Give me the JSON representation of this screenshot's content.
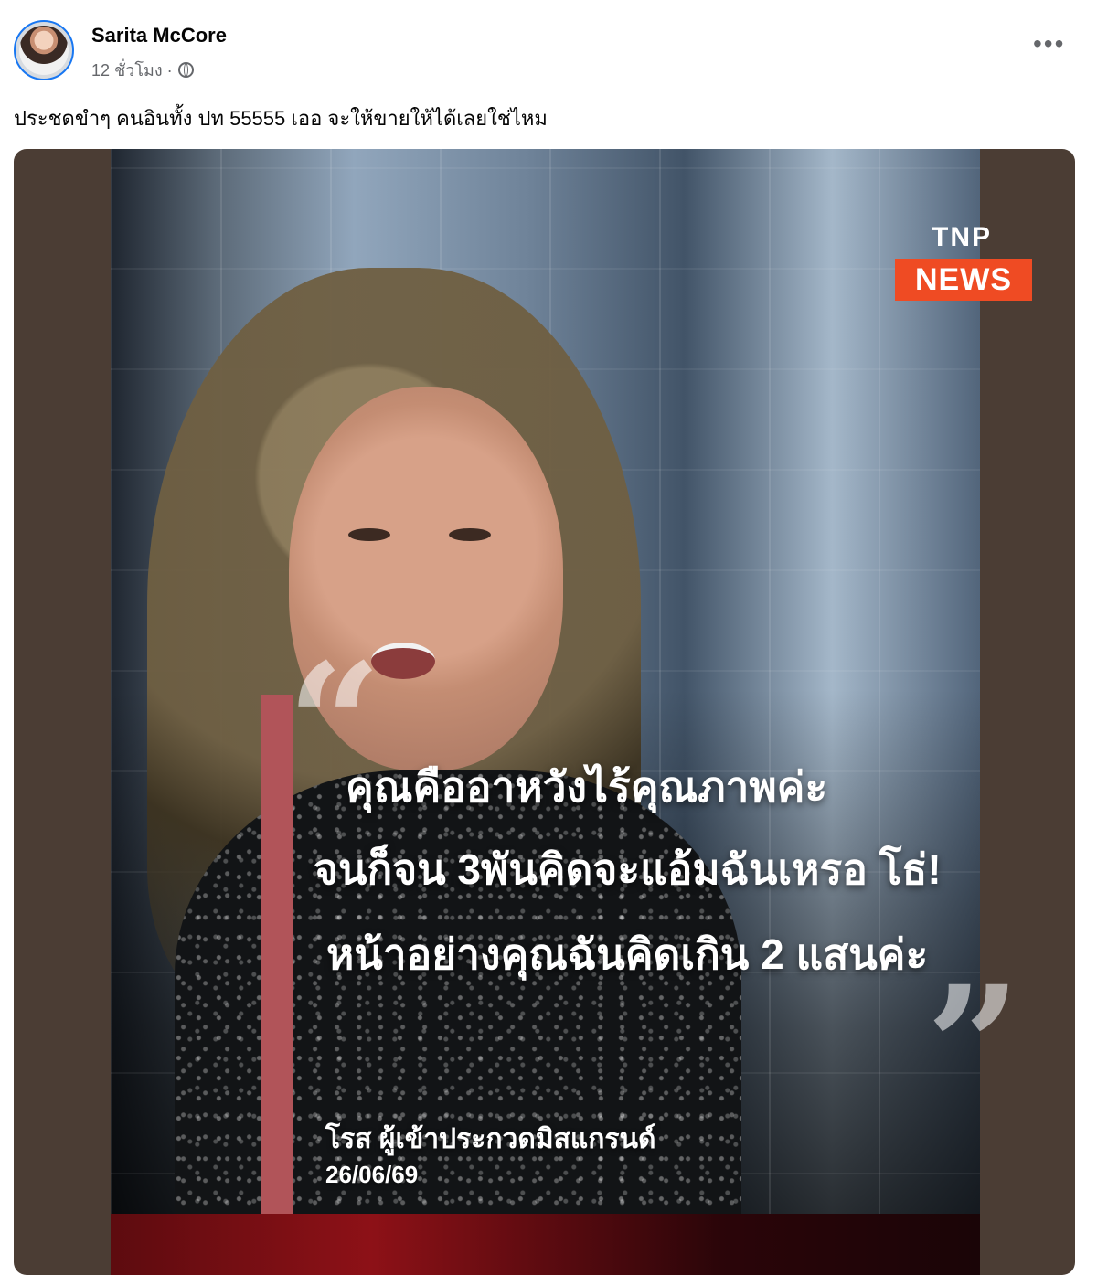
{
  "post": {
    "author": "Sarita McCore",
    "time": "12 ชั่วโมง ·",
    "visibility_icon": "globe-icon",
    "more_label": "•••",
    "text": "ประชดขำๆ คนอินทั้ง ปท 55555 เออ จะให้ขายให้ได้เลยใช่ไหม"
  },
  "media": {
    "logo_top": "TNP",
    "logo_bottom": "NEWS",
    "quote_open": "“",
    "quote_close": "”",
    "quote_lines": [
      "คุณคืออาหวังไร้คุณภาพค่ะ",
      "จนก็จน 3พันคิดจะแอ้มฉันเหรอ โธ่!",
      "หน้าอย่างคุณฉันคิดเกิน 2 แสนค่ะ"
    ],
    "caption_name": "โรส ผู้เข้าประกวดมิสแกรนด์",
    "caption_date": "26/06/69"
  },
  "colors": {
    "news_orange": "#ef4b23",
    "quote_bar": "#b15459",
    "media_bg": "#4b3d34"
  }
}
